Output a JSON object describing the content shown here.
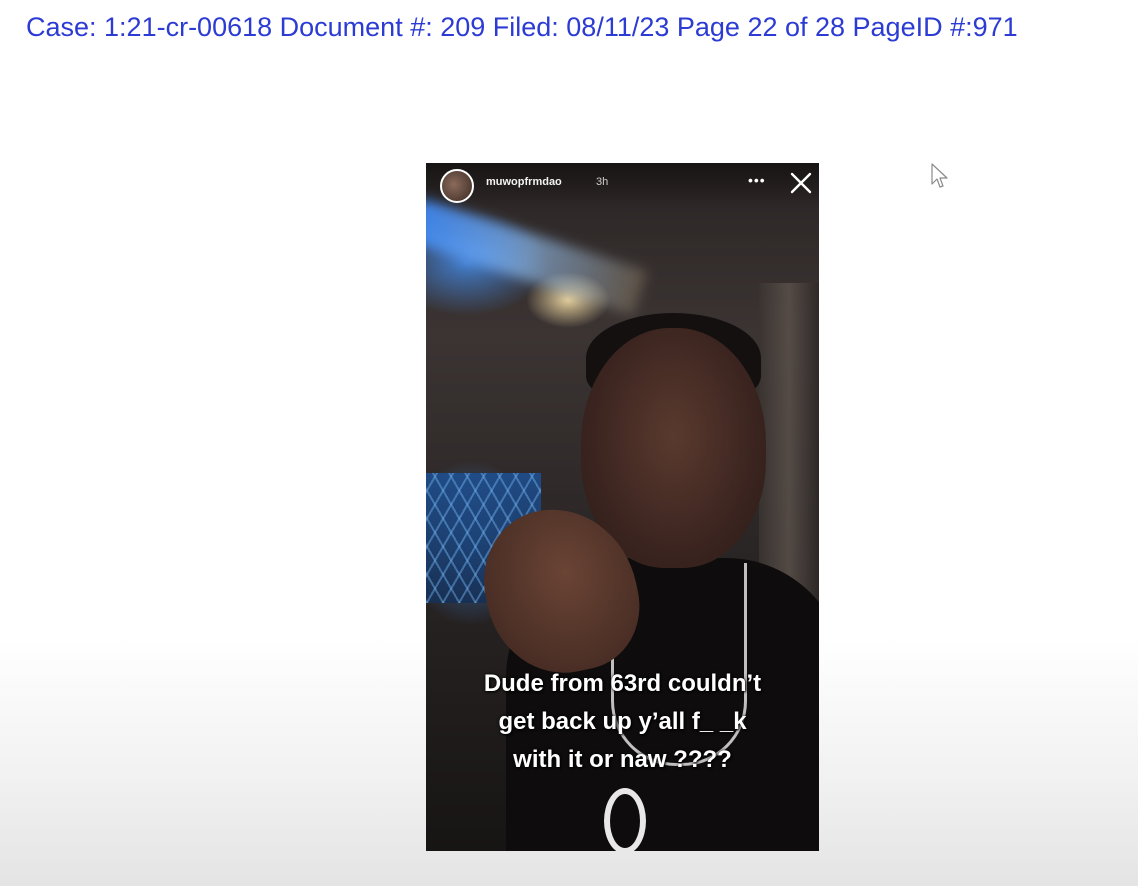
{
  "header": {
    "case_line": "Case: 1:21-cr-00618 Document #: 209 Filed: 08/11/23 Page 22 of 28 PageID #:971"
  },
  "story": {
    "username": "muwopfrmdao",
    "timestamp": "3h",
    "more_glyph": "•••",
    "caption_lines": [
      "Dude from 63rd couldn’t",
      "get back up y’all f_ _k",
      "with it or naw ????"
    ]
  },
  "colors": {
    "header_text": "#2b3bd3"
  },
  "icons": {
    "more": "more-options-icon",
    "close": "close-icon",
    "cursor": "mouse-cursor-icon"
  }
}
